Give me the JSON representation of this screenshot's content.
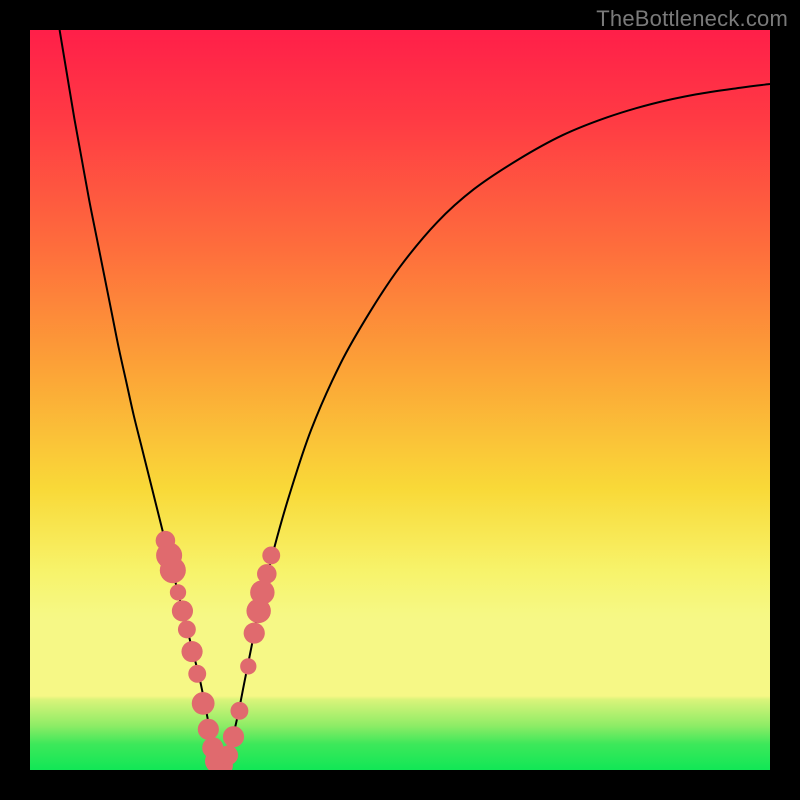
{
  "watermark": {
    "text": "TheBottleneck.com"
  },
  "colors": {
    "black": "#000000",
    "curve": "#000000",
    "marker_fill": "#e06a6e",
    "marker_stroke": "#d85c60",
    "green": "#18e858",
    "greenish": "#6de86a",
    "yellow_pale": "#f6f884",
    "yellow": "#f9e73a",
    "orange": "#fca037",
    "orange2": "#fd7f3a",
    "red_orange": "#fe5a40",
    "red": "#ff2b47",
    "red_top": "#ff1f49"
  },
  "chart_data": {
    "type": "line",
    "title": "",
    "xlabel": "",
    "ylabel": "",
    "xlim": [
      0,
      100
    ],
    "ylim": [
      0,
      100
    ],
    "grid": false,
    "legend": false,
    "description": "Bottleneck percentage vs component balance. V-shaped curve; minimum near x≈25 where bottleneck≈0%. Background is a vertical red→green gradient (top=high bottleneck, bottom=low).",
    "gradient_stops": [
      {
        "offset": 0.0,
        "color": "#ff1f49"
      },
      {
        "offset": 0.12,
        "color": "#ff3a44"
      },
      {
        "offset": 0.3,
        "color": "#fe6f3c"
      },
      {
        "offset": 0.45,
        "color": "#fca037"
      },
      {
        "offset": 0.62,
        "color": "#f9d938"
      },
      {
        "offset": 0.73,
        "color": "#f7f36a"
      },
      {
        "offset": 0.79,
        "color": "#f6f884"
      },
      {
        "offset": 0.8,
        "color": "#f6f886"
      },
      {
        "offset": 0.9,
        "color": "#f6f886"
      },
      {
        "offset": 0.905,
        "color": "#d9f47a"
      },
      {
        "offset": 0.94,
        "color": "#8eec66"
      },
      {
        "offset": 0.965,
        "color": "#3de85a"
      },
      {
        "offset": 1.0,
        "color": "#11e756"
      }
    ],
    "curve": {
      "x": [
        4,
        5,
        6,
        7,
        8,
        9,
        10,
        11,
        12,
        13,
        14,
        15,
        16,
        17,
        18,
        19,
        20,
        21,
        22,
        23,
        24,
        25,
        26,
        27,
        28,
        29,
        30,
        31,
        33,
        35,
        38,
        42,
        46,
        50,
        55,
        60,
        66,
        72,
        78,
        84,
        90,
        96,
        100
      ],
      "y": [
        100,
        94,
        88,
        82.5,
        77,
        72,
        67,
        62,
        57,
        52.5,
        48,
        44,
        40,
        36,
        32,
        28,
        24,
        20,
        16,
        12,
        7,
        2,
        0.5,
        3,
        7,
        12,
        17,
        22,
        30,
        37,
        46,
        55,
        62,
        68,
        74,
        78.5,
        82.5,
        85.8,
        88.2,
        90,
        91.3,
        92.2,
        92.7
      ]
    },
    "markers": [
      {
        "x": 18.3,
        "y": 31.0,
        "r": 2.4
      },
      {
        "x": 18.8,
        "y": 29.0,
        "r": 3.2
      },
      {
        "x": 19.3,
        "y": 27.0,
        "r": 3.2
      },
      {
        "x": 20.0,
        "y": 24.0,
        "r": 2.0
      },
      {
        "x": 20.6,
        "y": 21.5,
        "r": 2.6
      },
      {
        "x": 21.2,
        "y": 19.0,
        "r": 2.2
      },
      {
        "x": 21.9,
        "y": 16.0,
        "r": 2.6
      },
      {
        "x": 22.6,
        "y": 13.0,
        "r": 2.2
      },
      {
        "x": 23.4,
        "y": 9.0,
        "r": 2.8
      },
      {
        "x": 24.1,
        "y": 5.5,
        "r": 2.6
      },
      {
        "x": 24.7,
        "y": 3.0,
        "r": 2.6
      },
      {
        "x": 25.3,
        "y": 1.2,
        "r": 3.0
      },
      {
        "x": 26.1,
        "y": 0.6,
        "r": 2.4
      },
      {
        "x": 26.8,
        "y": 2.0,
        "r": 2.4
      },
      {
        "x": 27.5,
        "y": 4.5,
        "r": 2.6
      },
      {
        "x": 28.3,
        "y": 8.0,
        "r": 2.2
      },
      {
        "x": 29.5,
        "y": 14.0,
        "r": 2.0
      },
      {
        "x": 30.3,
        "y": 18.5,
        "r": 2.6
      },
      {
        "x": 30.9,
        "y": 21.5,
        "r": 3.0
      },
      {
        "x": 31.4,
        "y": 24.0,
        "r": 3.0
      },
      {
        "x": 32.0,
        "y": 26.5,
        "r": 2.4
      },
      {
        "x": 32.6,
        "y": 29.0,
        "r": 2.2
      }
    ]
  }
}
